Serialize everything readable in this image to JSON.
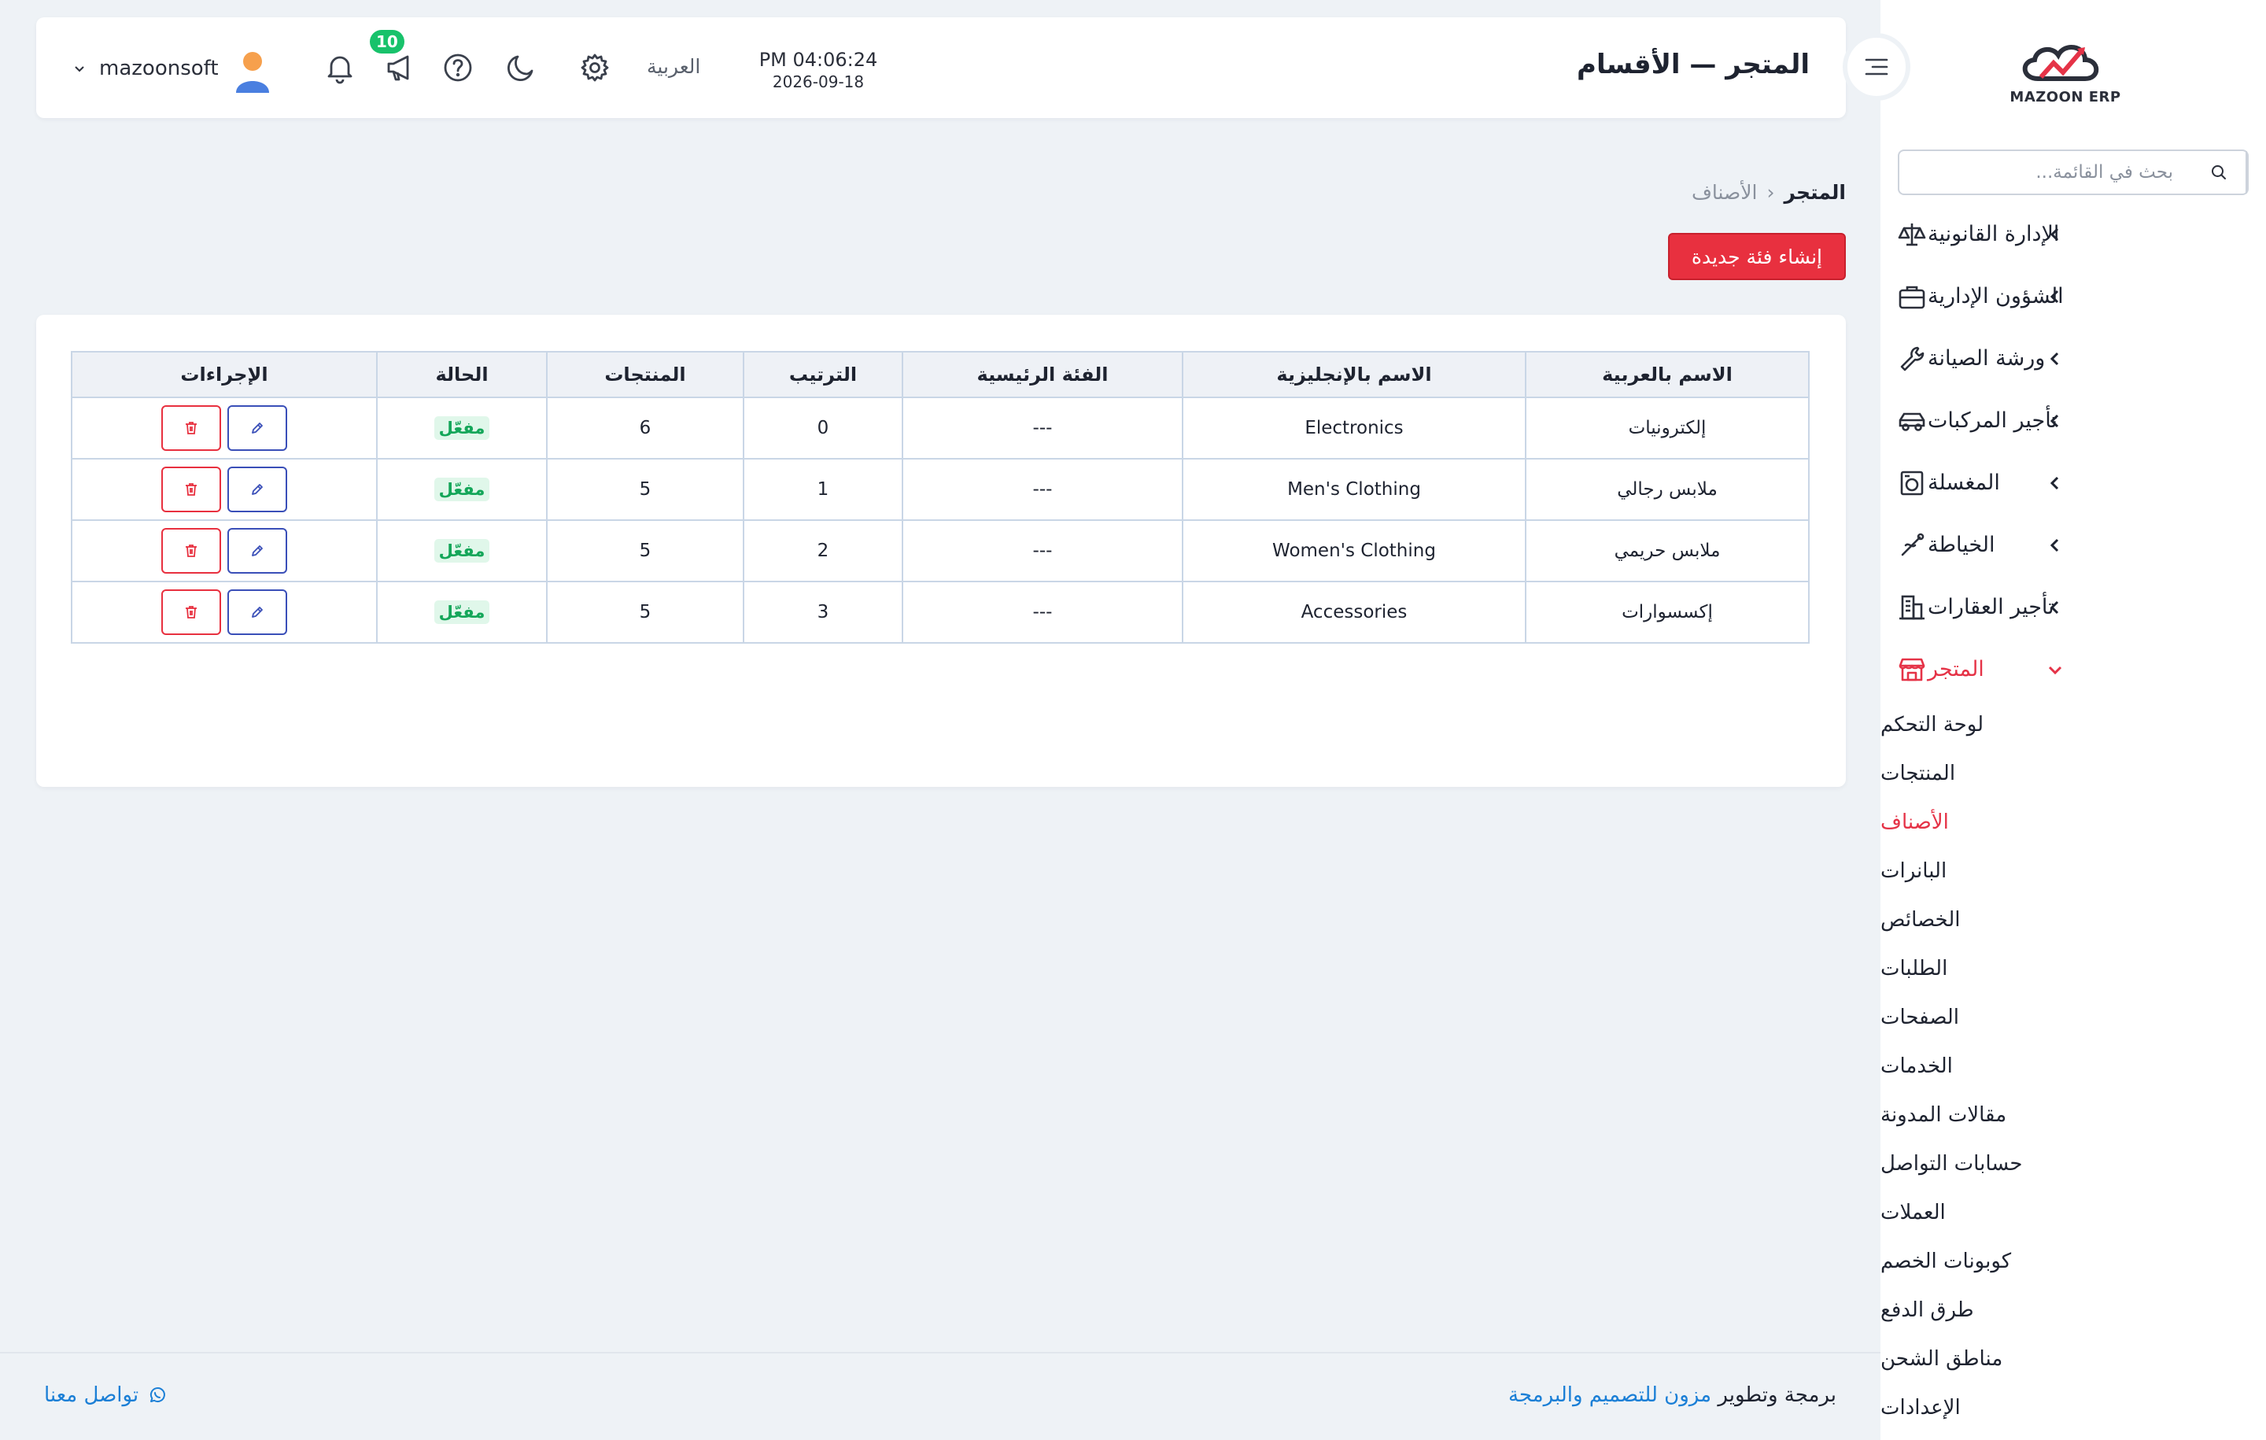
{
  "brand": {
    "logo_text": "MAZOON ERP",
    "accent": "#e53347"
  },
  "sidebar": {
    "search_placeholder": "بحث في القائمة...",
    "items": [
      {
        "label": "الإدارة القانونية",
        "icon": "scale-icon"
      },
      {
        "label": "الشؤون الإدارية",
        "icon": "briefcase-icon"
      },
      {
        "label": "ورشة الصيانة",
        "icon": "wrench-icon"
      },
      {
        "label": "تأجير المركبات",
        "icon": "car-icon"
      },
      {
        "label": "المغسلة",
        "icon": "laundry-icon"
      },
      {
        "label": "الخياطة",
        "icon": "needle-icon"
      },
      {
        "label": "تأجير العقارات",
        "icon": "building-icon"
      },
      {
        "label": "المتجر",
        "icon": "store-icon",
        "active": true
      }
    ],
    "store_submenu": [
      "لوحة التحكم",
      "المنتجات",
      "الأصناف",
      "البانرات",
      "الخصائص",
      "الطلبات",
      "الصفحات",
      "الخدمات",
      "مقالات المدونة",
      "حسابات التواصل",
      "العملات",
      "كوبونات الخصم",
      "طرق الدفع",
      "مناطق الشحن",
      "الإعدادات"
    ],
    "active_sub": "الأصناف"
  },
  "header": {
    "title": "المتجر — الأقسام",
    "time": "PM 04:06:24",
    "date": "2026-09-18",
    "language": "العربية",
    "notification_count": "10",
    "username": "mazoonsoft"
  },
  "breadcrumb": {
    "root": "المتجر",
    "separator": "‹",
    "current": "الأصناف"
  },
  "actions": {
    "create_label": "إنشاء فئة جديدة"
  },
  "table": {
    "headers": [
      "الاسم بالعربية",
      "الاسم بالإنجليزية",
      "الفئة الرئيسية",
      "الترتيب",
      "المنتجات",
      "الحالة",
      "الإجراءات"
    ],
    "rows": [
      {
        "name_ar": "إلكترونيات",
        "name_en": "Electronics",
        "parent": "---",
        "order": "0",
        "products": "6",
        "status": "مفعّل"
      },
      {
        "name_ar": "ملابس رجالي",
        "name_en": "Men's Clothing",
        "parent": "---",
        "order": "1",
        "products": "5",
        "status": "مفعّل"
      },
      {
        "name_ar": "ملابس حريمي",
        "name_en": "Women's Clothing",
        "parent": "---",
        "order": "2",
        "products": "5",
        "status": "مفعّل"
      },
      {
        "name_ar": "إكسسوارات",
        "name_en": "Accessories",
        "parent": "---",
        "order": "3",
        "products": "5",
        "status": "مفعّل"
      }
    ]
  },
  "footer": {
    "credit_prefix": "برمجة وتطوير",
    "credit_link": "مزون للتصميم والبرمجة",
    "contact": "تواصل معنا"
  }
}
